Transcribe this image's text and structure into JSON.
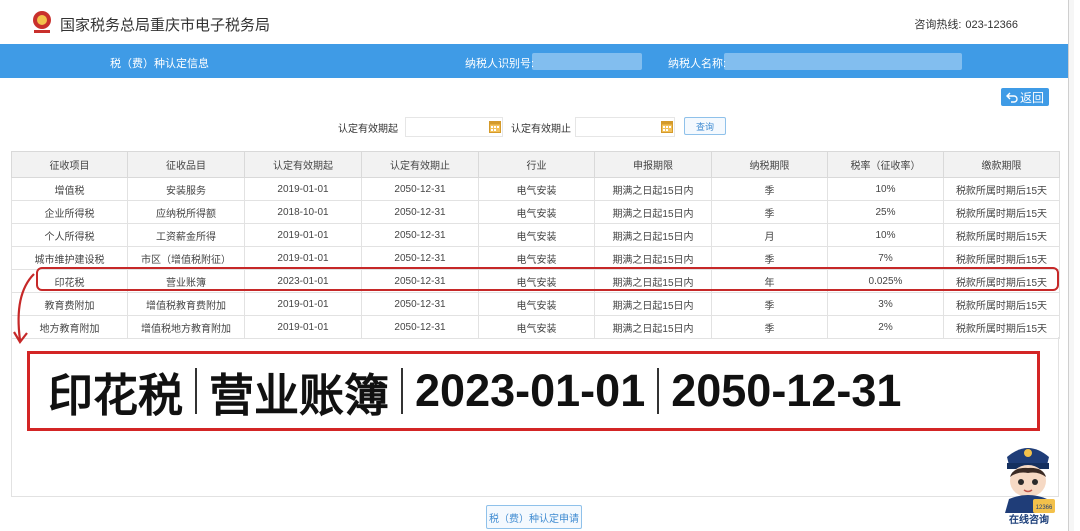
{
  "header": {
    "title": "国家税务总局重庆市电子税务局",
    "hotline_label": "咨询热线:",
    "hotline_number": "023-12366"
  },
  "infobar": {
    "section_title": "税（费）种认定信息",
    "taxpayer_id_label": "纳税人识别号:",
    "taxpayer_name_label": "纳税人名称:"
  },
  "back_button": "返回",
  "query": {
    "start_label": "认定有效期起",
    "end_label": "认定有效期止",
    "start_value": "",
    "end_value": "",
    "search_button": "查询"
  },
  "table": {
    "headers": [
      "征收项目",
      "征收品目",
      "认定有效期起",
      "认定有效期止",
      "行业",
      "申报期限",
      "纳税期限",
      "税率（征收率）",
      "缴款期限"
    ],
    "rows": [
      [
        "增值税",
        "安装服务",
        "2019-01-01",
        "2050-12-31",
        "电气安装",
        "期满之日起15日内",
        "季",
        "10%",
        "税款所属时期后15天"
      ],
      [
        "企业所得税",
        "应纳税所得额",
        "2018-10-01",
        "2050-12-31",
        "电气安装",
        "期满之日起15日内",
        "季",
        "25%",
        "税款所属时期后15天"
      ],
      [
        "个人所得税",
        "工资薪金所得",
        "2019-01-01",
        "2050-12-31",
        "电气安装",
        "期满之日起15日内",
        "月",
        "10%",
        "税款所属时期后15天"
      ],
      [
        "城市维护建设税",
        "市区（增值税附征）",
        "2019-01-01",
        "2050-12-31",
        "电气安装",
        "期满之日起15日内",
        "季",
        "7%",
        "税款所属时期后15天"
      ],
      [
        "印花税",
        "营业账簿",
        "2023-01-01",
        "2050-12-31",
        "电气安装",
        "期满之日起15日内",
        "年",
        "0.025%",
        "税款所属时期后15天"
      ],
      [
        "教育费附加",
        "增值税教育费附加",
        "2019-01-01",
        "2050-12-31",
        "电气安装",
        "期满之日起15日内",
        "季",
        "3%",
        "税款所属时期后15天"
      ],
      [
        "地方教育附加",
        "增值税地方教育附加",
        "2019-01-01",
        "2050-12-31",
        "电气安装",
        "期满之日起15日内",
        "季",
        "2%",
        "税款所属时期后15天"
      ]
    ]
  },
  "callout": {
    "item": "印花税",
    "sub_item": "营业账簿",
    "valid_from": "2023-01-01",
    "valid_to": "2050-12-31"
  },
  "apply_button": "税（费）种认定申请",
  "mascot": {
    "label": "在线咨询",
    "badge": "12366"
  },
  "colors": {
    "header_blue": "#3f9be6",
    "highlight_red": "#c62828"
  }
}
